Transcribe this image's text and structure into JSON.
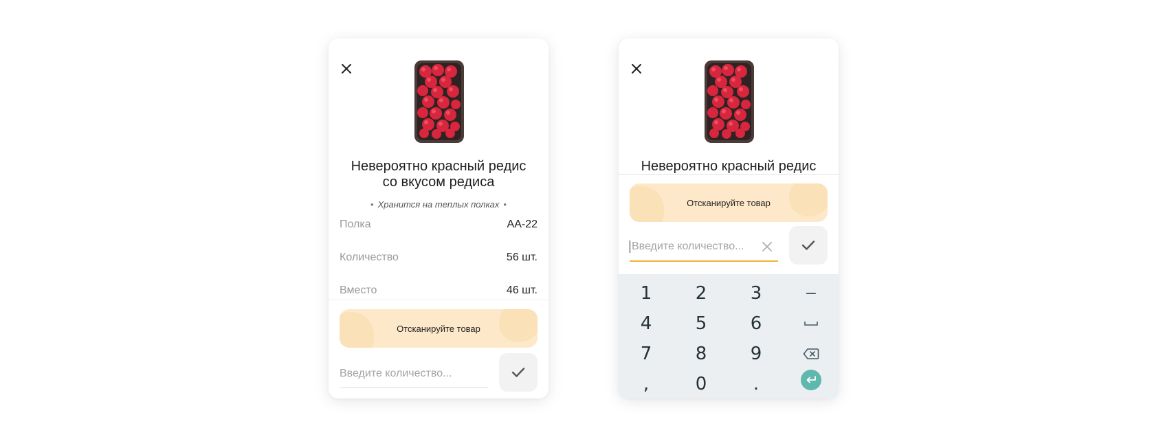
{
  "screens": [
    {
      "product": {
        "title_line1": "Невероятно красный редис",
        "title_line2": "со вкусом редиса",
        "storage_note": "Хранится на теплых полках",
        "image_icon": "radish-tray-image"
      },
      "details": [
        {
          "label": "Полка",
          "value": "АА-22"
        },
        {
          "label": "Количество",
          "value": "56 шт."
        },
        {
          "label": "Вместо",
          "value": "46 шт."
        }
      ],
      "scan_button_label": "Отсканируйте товар",
      "quantity_input": {
        "value": "",
        "placeholder": "Введите количество..."
      },
      "icons": {
        "close": "close-icon",
        "confirm": "check-icon"
      }
    },
    {
      "product": {
        "title_line1": "Невероятно красный редис",
        "image_icon": "radish-tray-image"
      },
      "scan_button_label": "Отсканируйте товар",
      "quantity_input": {
        "value": "",
        "placeholder": "Введите количество..."
      },
      "keypad": {
        "rows": [
          [
            "1",
            "2",
            "3",
            "−"
          ],
          [
            "4",
            "5",
            "6",
            "␣"
          ],
          [
            "7",
            "8",
            "9",
            "⌫"
          ],
          [
            ",",
            "0",
            ".",
            "↵"
          ]
        ]
      },
      "icons": {
        "close": "close-icon",
        "confirm": "check-icon",
        "clear": "clear-icon",
        "enter": "enter-icon"
      }
    }
  ],
  "colors": {
    "accent_yellow": "#f2b335",
    "scan_button_bg": "#fde9c9",
    "enter_key": "#5fb8ad",
    "keypad_bg": "#eceff1"
  }
}
